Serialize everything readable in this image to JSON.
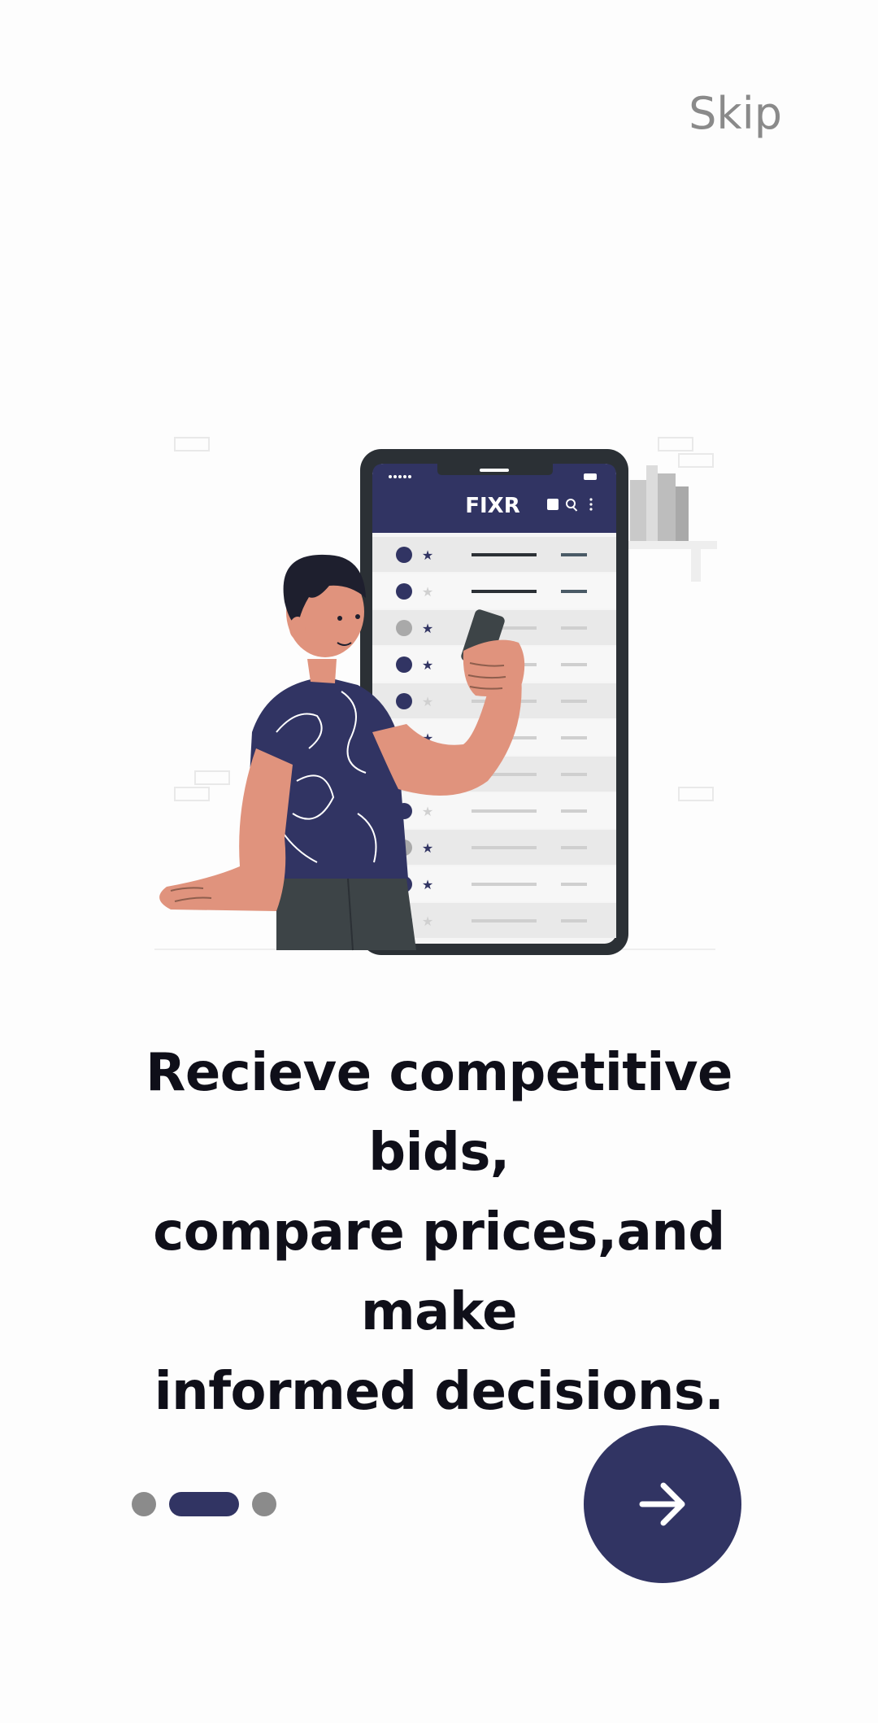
{
  "header": {
    "skip_label": "Skip"
  },
  "illustration": {
    "app_logo_text": "FIXR",
    "phone_list_rows": 11,
    "icon": "person-holding-phone-illustration"
  },
  "main": {
    "headline_lines": [
      "Recieve competitive bids,",
      "compare prices,and make",
      "informed decisions."
    ]
  },
  "pager": {
    "count": 3,
    "active_index": 1
  },
  "next_button": {
    "icon": "arrow-right-icon"
  },
  "colors": {
    "brand_navy": "#313463",
    "inactive_dot": "#8b8b8b",
    "skin": "#e0937d",
    "headline": "#0f0f19",
    "skip": "#8a8a8a"
  }
}
